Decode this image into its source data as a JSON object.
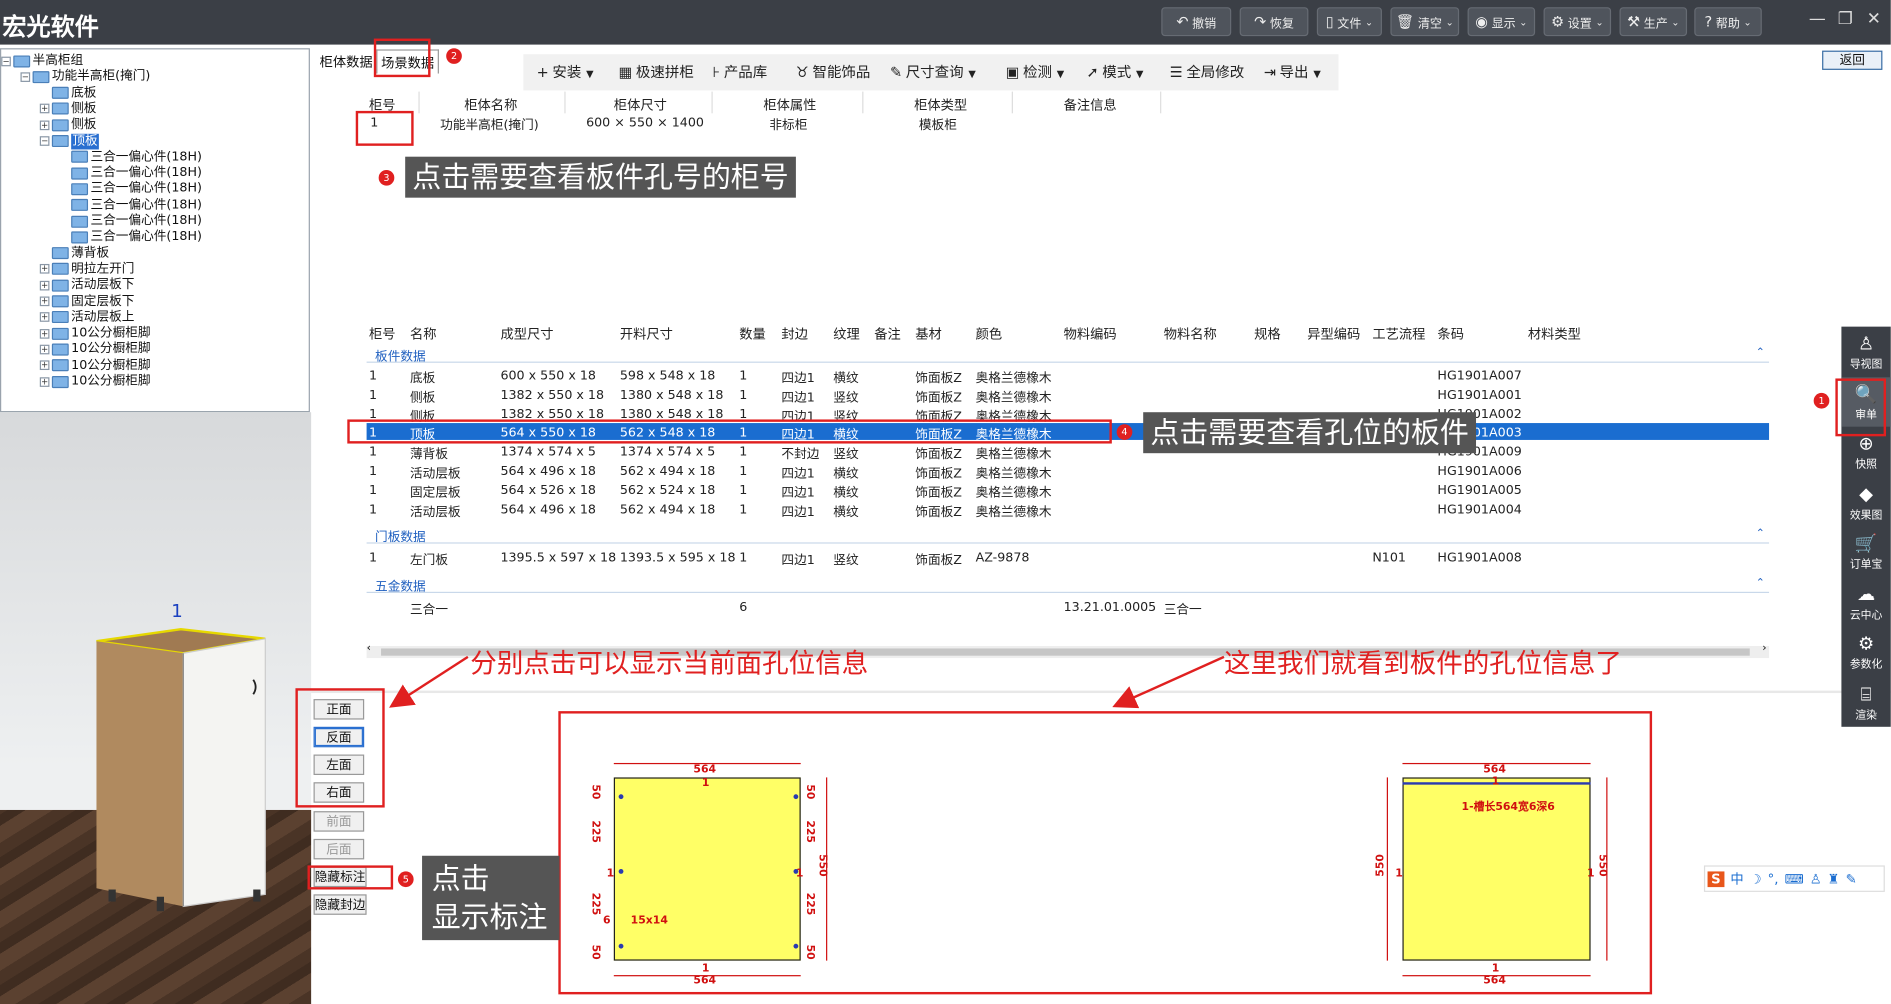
{
  "app": {
    "title": "宏光软件"
  },
  "toolbar": [
    {
      "icon": "undo-icon",
      "glyph": "↶",
      "label": "撤销"
    },
    {
      "icon": "redo-icon",
      "glyph": "↷",
      "label": "恢复"
    },
    {
      "icon": "file-icon",
      "glyph": "▯",
      "label": "文件"
    },
    {
      "icon": "trash-icon",
      "glyph": "🗑",
      "label": "清空"
    },
    {
      "icon": "eye-icon",
      "glyph": "◉",
      "label": "显示"
    },
    {
      "icon": "gear-icon",
      "glyph": "⚙",
      "label": "设置"
    },
    {
      "icon": "hammer-icon",
      "glyph": "⚒",
      "label": "生产"
    },
    {
      "icon": "help-icon",
      "glyph": "?",
      "label": "帮助"
    }
  ],
  "window": {
    "minimize": "—",
    "restore": "❐",
    "close": "✕"
  },
  "tree": [
    {
      "label": "半高柜组",
      "level": 0,
      "exp": "−"
    },
    {
      "label": "功能半高柜(掩门)",
      "level": 1,
      "exp": "−"
    },
    {
      "label": "底板",
      "level": 2,
      "exp": ""
    },
    {
      "label": "侧板",
      "level": 2,
      "exp": "+"
    },
    {
      "label": "侧板",
      "level": 2,
      "exp": "+"
    },
    {
      "label": "顶板",
      "level": 2,
      "exp": "−",
      "selected": true
    },
    {
      "label": "三合一偏心件(18H)",
      "level": 3,
      "exp": ""
    },
    {
      "label": "三合一偏心件(18H)",
      "level": 3,
      "exp": ""
    },
    {
      "label": "三合一偏心件(18H)",
      "level": 3,
      "exp": ""
    },
    {
      "label": "三合一偏心件(18H)",
      "level": 3,
      "exp": ""
    },
    {
      "label": "三合一偏心件(18H)",
      "level": 3,
      "exp": ""
    },
    {
      "label": "三合一偏心件(18H)",
      "level": 3,
      "exp": ""
    },
    {
      "label": "薄背板",
      "level": 2,
      "exp": ""
    },
    {
      "label": "明拉左开门",
      "level": 2,
      "exp": "+"
    },
    {
      "label": "活动层板下",
      "level": 2,
      "exp": "+"
    },
    {
      "label": "固定层板下",
      "level": 2,
      "exp": "+"
    },
    {
      "label": "活动层板上",
      "level": 2,
      "exp": "+"
    },
    {
      "label": "10公分橱柜脚",
      "level": 2,
      "exp": "+"
    },
    {
      "label": "10公分橱柜脚",
      "level": 2,
      "exp": "+"
    },
    {
      "label": "10公分橱柜脚",
      "level": 2,
      "exp": "+"
    },
    {
      "label": "10公分橱柜脚",
      "level": 2,
      "exp": "+"
    }
  ],
  "view3d": {
    "cabinet_number": "1"
  },
  "tabs": [
    "柜体数据",
    "场景数据"
  ],
  "toolbar2": [
    {
      "icon": "plus-icon",
      "glyph": "+",
      "label": "安装",
      "drop": true
    },
    {
      "icon": "grid-icon",
      "glyph": "▦",
      "label": "极速拼柜",
      "drop": false
    },
    {
      "icon": "library-icon",
      "glyph": "⊦",
      "label": "产品库",
      "drop": false
    },
    {
      "icon": "ornament-icon",
      "glyph": "♉",
      "label": "智能饰品",
      "drop": false
    },
    {
      "icon": "ruler-icon",
      "glyph": "✎",
      "label": "尺寸查询",
      "drop": true
    },
    {
      "icon": "check-icon",
      "glyph": "▣",
      "label": "检测",
      "drop": true
    },
    {
      "icon": "cursor-icon",
      "glyph": "➚",
      "label": "模式",
      "drop": true
    },
    {
      "icon": "list-icon",
      "glyph": "☰",
      "label": "全局修改",
      "drop": false
    },
    {
      "icon": "export-icon",
      "glyph": "⇥",
      "label": "导出",
      "drop": true
    }
  ],
  "back_label": "返回",
  "cabinet_table": {
    "headers": [
      "柜号",
      "柜体名称",
      "柜体尺寸",
      "柜体属性",
      "柜体类型",
      "备注信息"
    ],
    "row": [
      "1",
      "功能半高柜(掩门)",
      "600 × 550 × 1400",
      "非标柜",
      "模板柜",
      ""
    ]
  },
  "parts_table": {
    "headers": [
      "柜号",
      "名称",
      "成型尺寸",
      "开料尺寸",
      "数量",
      "封边",
      "纹理",
      "备注",
      "基材",
      "颜色",
      "物料编码",
      "物料名称",
      "规格",
      "异型编码",
      "工艺流程",
      "条码",
      "材料类型"
    ],
    "sections": [
      {
        "title": "板件数据",
        "rows": [
          [
            "1",
            "底板",
            "600 x 550 x 18",
            "598 x 548 x 18",
            "1",
            "四边1",
            "横纹",
            "",
            "饰面板Z",
            "奥格兰德橡木",
            "",
            "",
            "",
            "",
            "",
            "HG1901A007",
            ""
          ],
          [
            "1",
            "侧板",
            "1382 x 550 x 18",
            "1380 x 548 x 18",
            "1",
            "四边1",
            "竖纹",
            "",
            "饰面板Z",
            "奥格兰德橡木",
            "",
            "",
            "",
            "",
            "",
            "HG1901A001",
            ""
          ],
          [
            "1",
            "侧板",
            "1382 x 550 x 18",
            "1380 x 548 x 18",
            "1",
            "四边1",
            "竖纹",
            "",
            "饰面板Z",
            "奥格兰德橡木",
            "",
            "",
            "",
            "",
            "",
            "HG1901A002",
            ""
          ],
          [
            "1",
            "顶板",
            "564 x 550 x 18",
            "562 x 548 x 18",
            "1",
            "四边1",
            "横纹",
            "",
            "饰面板Z",
            "奥格兰德橡木",
            "",
            "",
            "",
            "",
            "",
            "HG1901A003",
            ""
          ],
          [
            "1",
            "薄背板",
            "1374 x 574 x 5",
            "1374 x 574 x 5",
            "1",
            "不封边",
            "竖纹",
            "",
            "饰面板Z",
            "奥格兰德橡木",
            "",
            "",
            "",
            "",
            "",
            "HG1901A009",
            ""
          ],
          [
            "1",
            "活动层板",
            "564 x 496 x 18",
            "562 x 494 x 18",
            "1",
            "四边1",
            "横纹",
            "",
            "饰面板Z",
            "奥格兰德橡木",
            "",
            "",
            "",
            "",
            "",
            "HG1901A006",
            ""
          ],
          [
            "1",
            "固定层板",
            "564 x 526 x 18",
            "562 x 524 x 18",
            "1",
            "四边1",
            "横纹",
            "",
            "饰面板Z",
            "奥格兰德橡木",
            "",
            "",
            "",
            "",
            "",
            "HG1901A005",
            ""
          ],
          [
            "1",
            "活动层板",
            "564 x 496 x 18",
            "562 x 494 x 18",
            "1",
            "四边1",
            "横纹",
            "",
            "饰面板Z",
            "奥格兰德橡木",
            "",
            "",
            "",
            "",
            "",
            "HG1901A004",
            ""
          ]
        ]
      },
      {
        "title": "门板数据",
        "rows": [
          [
            "1",
            "左门板",
            "1395.5 x 597 x 18",
            "1393.5 x 595 x 18",
            "1",
            "四边1",
            "竖纹",
            "",
            "饰面板Z",
            "AZ-9878",
            "",
            "",
            "",
            "",
            "N101",
            "HG1901A008",
            ""
          ]
        ]
      },
      {
        "title": "五金数据",
        "rows": [
          [
            "",
            "三合一",
            "",
            "",
            "6",
            "",
            "",
            "",
            "",
            "",
            "13.21.01.0005",
            "三合一",
            "",
            "",
            "",
            "",
            ""
          ]
        ]
      }
    ]
  },
  "right_sidebar": [
    {
      "icon": "navigation-icon",
      "glyph": "♙",
      "label": "导视图"
    },
    {
      "icon": "review-icon",
      "glyph": "🔍",
      "label": "审单"
    },
    {
      "icon": "snapshot-icon",
      "glyph": "⊕",
      "label": "快照"
    },
    {
      "icon": "cube-icon",
      "glyph": "◆",
      "label": "效果图"
    },
    {
      "icon": "cart-icon",
      "glyph": "🛒",
      "label": "订单宝"
    },
    {
      "icon": "cloud-icon",
      "glyph": "☁",
      "label": "云中心"
    },
    {
      "icon": "param-icon",
      "glyph": "⚙",
      "label": "参数化"
    },
    {
      "icon": "camera-icon",
      "glyph": "⌸",
      "label": "渲染"
    }
  ],
  "face_buttons": [
    {
      "label": "正面",
      "enabled": true
    },
    {
      "label": "反面",
      "enabled": true,
      "active": true
    },
    {
      "label": "左面",
      "enabled": true
    },
    {
      "label": "右面",
      "enabled": true
    },
    {
      "label": "前面",
      "enabled": false
    },
    {
      "label": "后面",
      "enabled": false
    },
    {
      "label": "隐藏标注",
      "enabled": true
    },
    {
      "label": "隐藏封边",
      "enabled": true
    }
  ],
  "annotations": {
    "step1": "1",
    "step2": "2",
    "step3": "3",
    "step4": "4",
    "step5": "5",
    "callout3": "点击需要查看板件孔号的柜号",
    "callout4": "点击需要查看孔位的板件",
    "callout5_line1": "点击",
    "callout5_line2": "显示标注",
    "note_left": "分别点击可以显示当前面孔位信息",
    "note_right": "这里我们就看到板件的孔位信息了"
  },
  "drawing_left": {
    "width": "564",
    "height": "550",
    "edge": "1",
    "left_dims": [
      "50",
      "225",
      "225",
      "50"
    ],
    "right_dims": [
      "50",
      "225",
      "225",
      "50"
    ],
    "hole_label": "15x14",
    "hole_count": "6"
  },
  "drawing_right": {
    "width": "564",
    "height": "550",
    "edge": "1",
    "groove_label": "1-槽长564宽6深6"
  },
  "ime": {
    "label": "中"
  },
  "colors": {
    "titlebar": "#3b3f46",
    "selection": "#1a6dd0",
    "annotation": "#e02020",
    "panel": "#ffff66"
  }
}
